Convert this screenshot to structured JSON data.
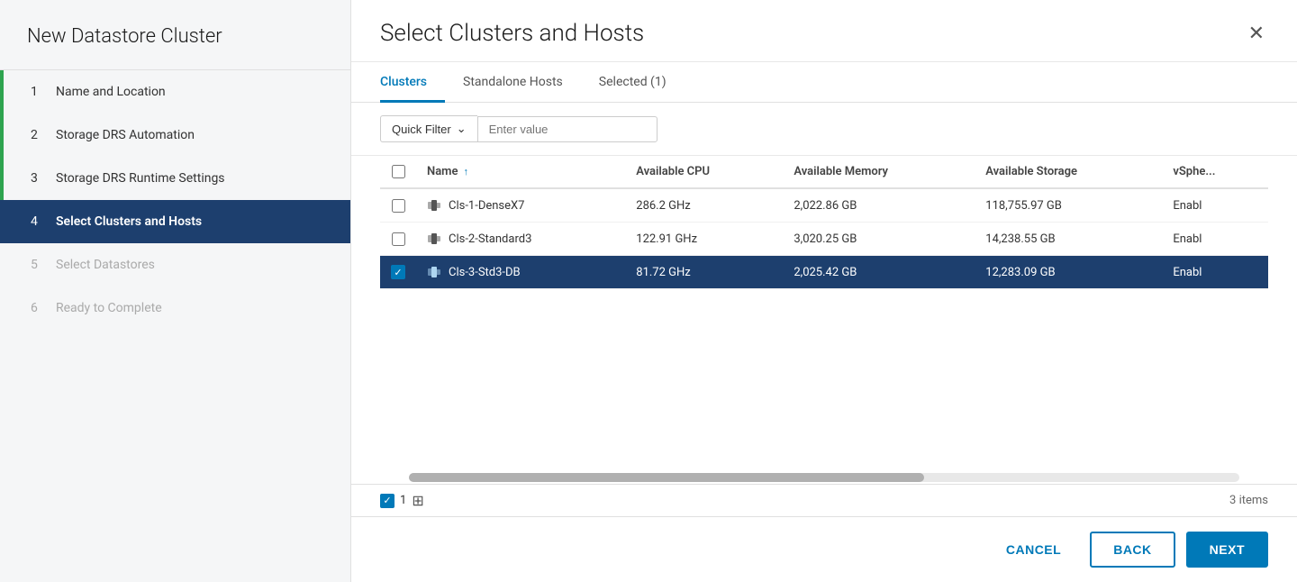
{
  "sidebar": {
    "title": "New Datastore Cluster",
    "steps": [
      {
        "num": "1",
        "label": "Name and Location",
        "state": "completed"
      },
      {
        "num": "2",
        "label": "Storage DRS Automation",
        "state": "completed"
      },
      {
        "num": "3",
        "label": "Storage DRS Runtime Settings",
        "state": "completed"
      },
      {
        "num": "4",
        "label": "Select Clusters and Hosts",
        "state": "active"
      },
      {
        "num": "5",
        "label": "Select Datastores",
        "state": "disabled"
      },
      {
        "num": "6",
        "label": "Ready to Complete",
        "state": "disabled"
      }
    ]
  },
  "main": {
    "title": "Select Clusters and Hosts",
    "tabs": [
      {
        "id": "clusters",
        "label": "Clusters",
        "active": true
      },
      {
        "id": "standalone-hosts",
        "label": "Standalone Hosts",
        "active": false
      },
      {
        "id": "selected",
        "label": "Selected (1)",
        "active": false
      }
    ],
    "filter": {
      "label": "Quick Filter",
      "placeholder": "Enter value"
    },
    "table": {
      "columns": [
        {
          "id": "checkbox",
          "label": ""
        },
        {
          "id": "name",
          "label": "Name"
        },
        {
          "id": "cpu",
          "label": "Available CPU"
        },
        {
          "id": "memory",
          "label": "Available Memory"
        },
        {
          "id": "storage",
          "label": "Available Storage"
        },
        {
          "id": "vsphere",
          "label": "vSphe..."
        }
      ],
      "rows": [
        {
          "id": "row1",
          "checked": false,
          "name": "Cls-1-DenseX7",
          "cpu": "286.2 GHz",
          "memory": "2,022.86 GB",
          "storage": "118,755.97 GB",
          "vsphere": "Enabl",
          "selected": false
        },
        {
          "id": "row2",
          "checked": false,
          "name": "Cls-2-Standard3",
          "cpu": "122.91 GHz",
          "memory": "3,020.25 GB",
          "storage": "14,238.55 GB",
          "vsphere": "Enabl",
          "selected": false
        },
        {
          "id": "row3",
          "checked": true,
          "name": "Cls-3-Std3-DB",
          "cpu": "81.72 GHz",
          "memory": "2,025.42 GB",
          "storage": "12,283.09 GB",
          "vsphere": "Enabl",
          "selected": true
        }
      ],
      "item_count": "3 items",
      "selected_count": "1"
    },
    "buttons": {
      "cancel": "CANCEL",
      "back": "BACK",
      "next": "NEXT"
    }
  }
}
